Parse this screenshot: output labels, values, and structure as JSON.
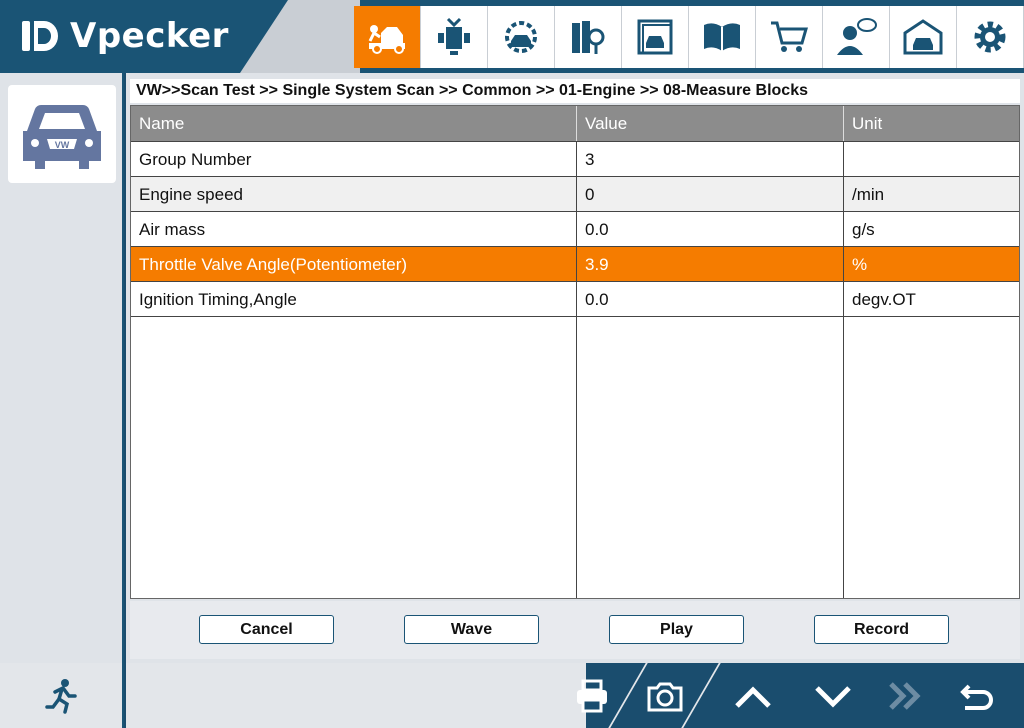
{
  "app": {
    "brand": "Vpecker"
  },
  "toolbar_icons": [
    {
      "name": "diagnose-icon",
      "active": true
    },
    {
      "name": "special-function-icon",
      "active": false
    },
    {
      "name": "service-icon",
      "active": false
    },
    {
      "name": "search-docs-icon",
      "active": false
    },
    {
      "name": "vehicle-info-icon",
      "active": false
    },
    {
      "name": "manual-icon",
      "active": false
    },
    {
      "name": "shop-cart-icon",
      "active": false
    },
    {
      "name": "feedback-icon",
      "active": false
    },
    {
      "name": "garage-icon",
      "active": false
    },
    {
      "name": "settings-icon",
      "active": false
    }
  ],
  "breadcrumb": "VW>>Scan Test >> Single System Scan >> Common >> 01-Engine >> 08-Measure Blocks",
  "table": {
    "headers": {
      "name": "Name",
      "value": "Value",
      "unit": "Unit"
    },
    "rows": [
      {
        "name": "Group Number",
        "value": "3",
        "unit": ""
      },
      {
        "name": "Engine speed",
        "value": "0",
        "unit": "/min"
      },
      {
        "name": "Air mass",
        "value": "0.0",
        "unit": "g/s"
      },
      {
        "name": "Throttle Valve Angle(Potentiometer)",
        "value": "3.9",
        "unit": "%"
      },
      {
        "name": "Ignition Timing,Angle",
        "value": "0.0",
        "unit": "degv.OT"
      }
    ],
    "selected_row": 3
  },
  "buttons": {
    "cancel": "Cancel",
    "wave": "Wave",
    "play": "Play",
    "record": "Record"
  },
  "colors": {
    "accent": "#f57c00",
    "brand": "#1a5475",
    "header": "#8c8c8c"
  }
}
